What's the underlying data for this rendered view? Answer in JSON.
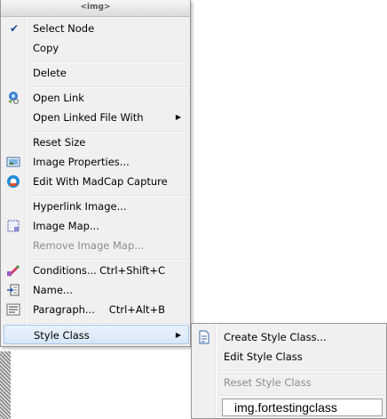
{
  "menu": {
    "header": "<img>",
    "items": [
      {
        "label": "Select Node",
        "checked": true
      },
      {
        "label": "Copy"
      },
      {
        "label": "Delete"
      },
      {
        "label": "Open Link",
        "icon": "open-link-icon"
      },
      {
        "label": "Open Linked File With",
        "submenu": true
      },
      {
        "label": "Reset Size"
      },
      {
        "label": "Image Properties...",
        "icon": "image-properties-icon"
      },
      {
        "label": "Edit With MadCap Capture",
        "icon": "madcap-capture-icon"
      },
      {
        "label": "Hyperlink Image..."
      },
      {
        "label": "Image Map...",
        "icon": "image-map-icon"
      },
      {
        "label": "Remove Image Map...",
        "disabled": true
      },
      {
        "label": "Conditions...",
        "shortcut": "Ctrl+Shift+C",
        "icon": "conditions-icon"
      },
      {
        "label": "Name...",
        "icon": "name-icon"
      },
      {
        "label": "Paragraph...",
        "shortcut": "Ctrl+Alt+B",
        "icon": "paragraph-icon"
      },
      {
        "label": "Style Class",
        "submenu": true,
        "highlighted": true
      }
    ]
  },
  "submenu": {
    "items": [
      {
        "label": "Create Style Class...",
        "icon": "create-style-class-icon"
      },
      {
        "label": "Edit Style Class"
      },
      {
        "label": "Reset Style Class",
        "disabled": true
      }
    ],
    "style_value": "img.fortestingclass"
  },
  "colors": {
    "menu_bg": "#f0f0f0",
    "highlight_border": "#a9c6ec",
    "disabled_text": "#8d8d8d"
  }
}
